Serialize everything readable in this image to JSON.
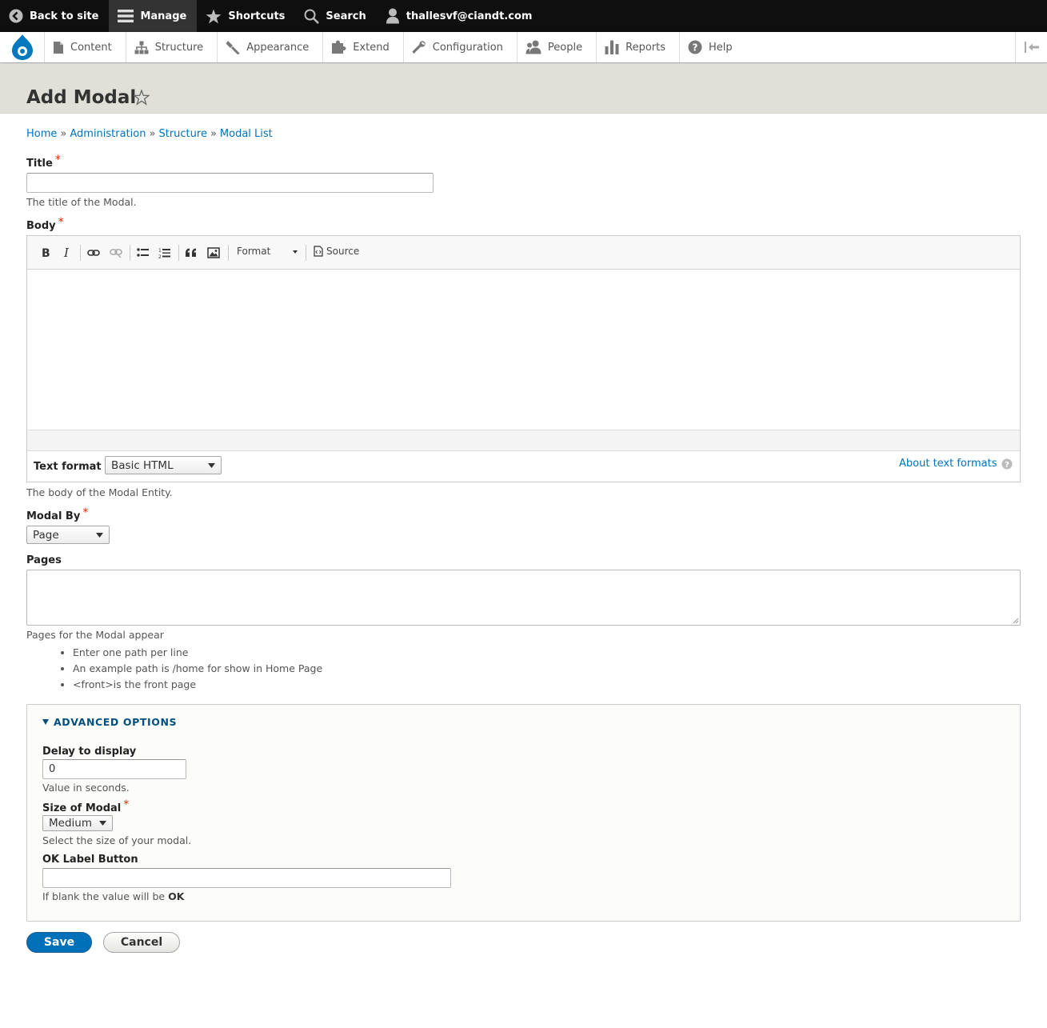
{
  "toolbar": {
    "back_to_site": "Back to site",
    "manage": "Manage",
    "shortcuts": "Shortcuts",
    "search": "Search",
    "user": "thallesvf@ciandt.com"
  },
  "tray": {
    "items": [
      "Content",
      "Structure",
      "Appearance",
      "Extend",
      "Configuration",
      "People",
      "Reports",
      "Help"
    ]
  },
  "page": {
    "title": "Add Modal"
  },
  "breadcrumb": [
    "Home",
    "Administration",
    "Structure",
    "Modal List"
  ],
  "form": {
    "title_label": "Title",
    "title_desc": "The title of the Modal.",
    "body_label": "Body",
    "editor_format": "Format",
    "editor_source": "Source",
    "text_format_label": "Text format",
    "text_format_value": "Basic HTML",
    "about_text_formats": "About text formats",
    "body_desc": "The body of the Modal Entity.",
    "modal_by_label": "Modal By",
    "modal_by_value": "Page",
    "pages_label": "Pages",
    "pages_desc": "Pages for the Modal appear",
    "pages_hints": [
      "Enter one path per line",
      "An example path is /home for show in Home Page",
      "<front>is the front page"
    ],
    "advanced_title": "ADVANCED OPTIONS",
    "delay_label": "Delay to display",
    "delay_value": "0",
    "delay_desc": "Value in seconds.",
    "size_label": "Size of Modal",
    "size_value": "Medium",
    "size_desc": "Select the size of your modal.",
    "ok_label": "OK Label Button",
    "ok_desc_prefix": "If blank the value will be ",
    "ok_desc_bold": "OK",
    "save": "Save",
    "cancel": "Cancel"
  }
}
